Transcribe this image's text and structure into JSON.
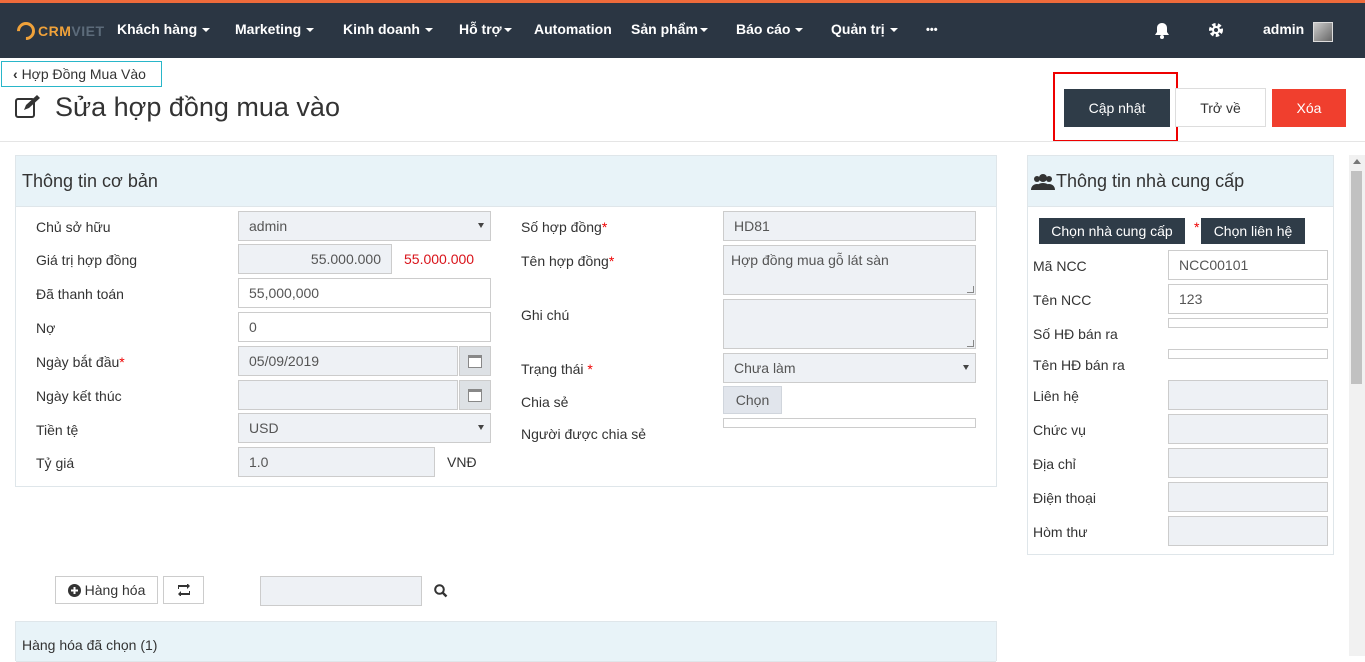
{
  "nav": {
    "logo_main": "CRM",
    "logo_sub": "VIET",
    "items": [
      "Khách hàng",
      "Marketing",
      "Kinh doanh",
      "Hỗ trợ",
      "Automation",
      "Sản phẩm",
      "Báo cáo",
      "Quản trị",
      "•••"
    ],
    "user": "admin"
  },
  "page": {
    "back_label": "Hợp Đồng Mua Vào",
    "title": "Sửa hợp đồng mua vào",
    "update_label": "Cập nhật",
    "return_label": "Trở về",
    "delete_label": "Xóa"
  },
  "basic": {
    "heading": "Thông tin cơ bản",
    "owner_label": "Chủ sở hữu",
    "owner_value": "admin",
    "value_label": "Giá trị hợp đồng",
    "value_input": "55.000.000",
    "value_red": "55.000.000",
    "paid_label": "Đã thanh toán",
    "paid_value": "55,000,000",
    "debt_label": "Nợ",
    "debt_value": "0",
    "start_label": "Ngày bắt đầu",
    "start_value": "05/09/2019",
    "end_label": "Ngày kết thúc",
    "end_value": "",
    "currency_label": "Tiền tệ",
    "currency_value": "USD",
    "rate_label": "Tỷ giá",
    "rate_value": "1.0",
    "rate_unit": "VNĐ",
    "contract_no_label": "Số hợp đồng",
    "contract_no_value": "HD81",
    "contract_name_label": "Tên hợp đồng",
    "contract_name_value": "Hợp đồng mua gỗ lát sàn",
    "note_label": "Ghi chú",
    "note_value": "",
    "status_label": "Trạng thái",
    "status_value": "Chưa làm",
    "share_label": "Chia sẻ",
    "share_button": "Chọn",
    "shared_with_label": "Người được chia sẻ"
  },
  "supplier": {
    "heading": "Thông tin nhà cung cấp",
    "choose_supplier": "Chọn nhà cung cấp",
    "choose_contact": "Chọn liên hệ",
    "code_label": "Mã NCC",
    "code_value": "NCC00101",
    "name_label": "Tên NCC",
    "name_value": "123",
    "sale_no_label": "Số HĐ bán ra",
    "sale_name_label": "Tên HĐ bán ra",
    "contact_label": "Liên hệ",
    "position_label": "Chức vụ",
    "address_label": "Địa chỉ",
    "phone_label": "Điện thoại",
    "email_label": "Hòm thư"
  },
  "goods": {
    "add_label": "Hàng hóa",
    "search_value": "",
    "selected_heading": "Hàng hóa đã chọn (1)"
  }
}
